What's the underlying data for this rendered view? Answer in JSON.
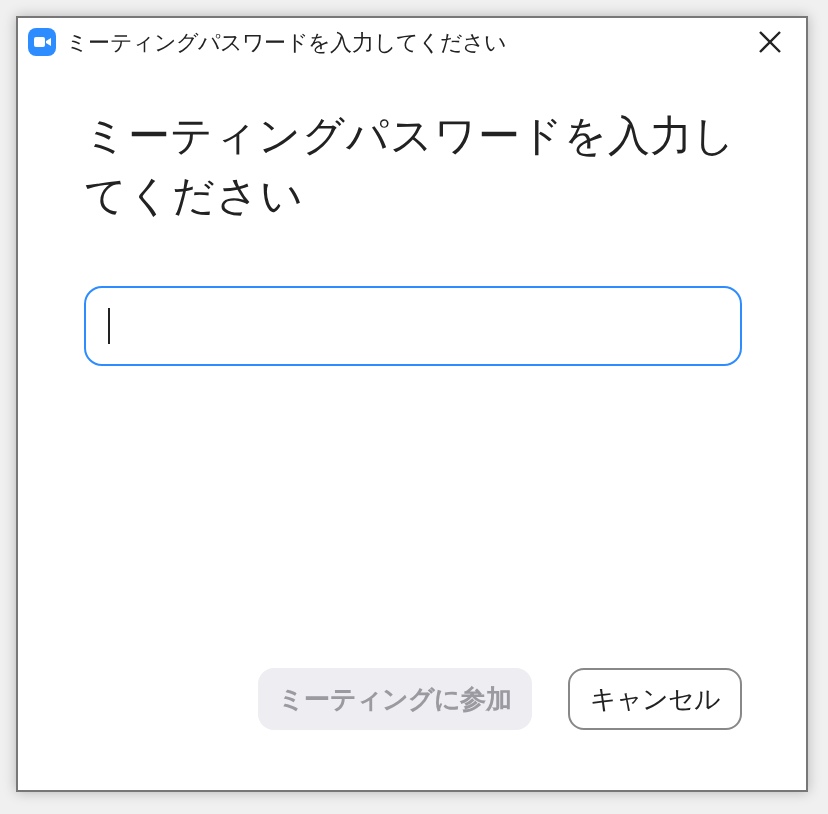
{
  "window": {
    "title": "ミーティングパスワードを入力してください"
  },
  "heading": "ミーティングパスワードを入力してください",
  "password_field": {
    "focused": true
  },
  "buttons": [
    {
      "label": "ミーティングに参加",
      "kind": "primary",
      "disabled": true
    },
    {
      "label": "キャンセル",
      "kind": "secondary",
      "disabled": false
    }
  ]
}
